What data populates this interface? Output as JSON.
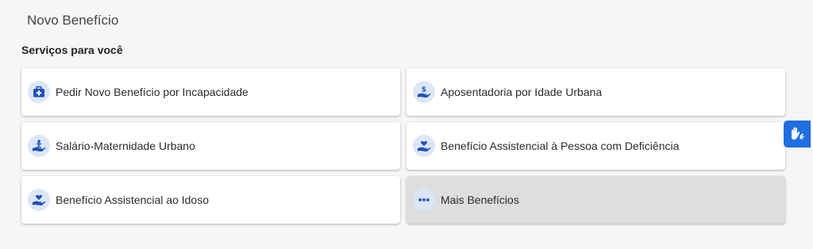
{
  "page": {
    "title": "Novo Benefício"
  },
  "section": {
    "title": "Serviços para você"
  },
  "colors": {
    "icon_blue": "#1f4fb8",
    "icon_bg": "#dce6f7",
    "accessibility_blue": "#1f6fe0",
    "more_card_bg": "#dedede"
  },
  "services": [
    {
      "label": "Pedir Novo Benefício por Incapacidade",
      "icon": "medical-kit-icon"
    },
    {
      "label": "Aposentadoria por Idade Urbana",
      "icon": "hand-dollar-icon"
    },
    {
      "label": "Salário-Maternidade Urbano",
      "icon": "hand-baby-icon"
    },
    {
      "label": "Benefício Assistencial à Pessoa com Deficiência",
      "icon": "hand-heart-icon"
    },
    {
      "label": "Benefício Assistencial ao Idoso",
      "icon": "hand-heart-icon"
    },
    {
      "label": "Mais Benefícios",
      "icon": "more-dots-icon"
    }
  ],
  "accessibility_widget": {
    "icon": "sign-language-hands-icon"
  }
}
